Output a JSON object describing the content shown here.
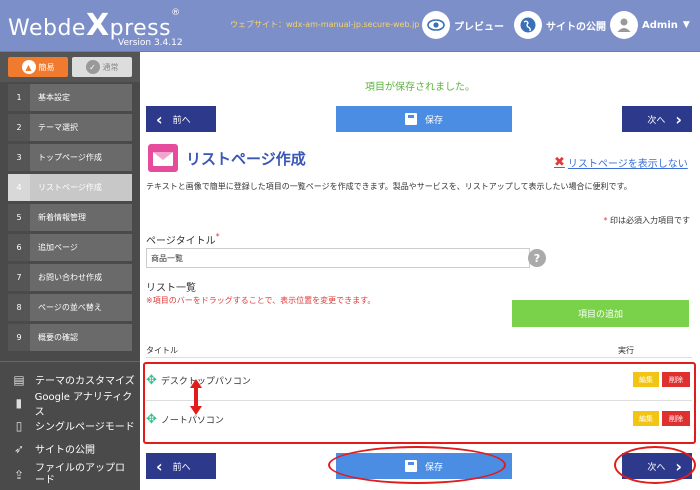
{
  "header": {
    "logo_pre": "Webde",
    "logo_x": "X",
    "logo_post": "press",
    "logo_reg": "®",
    "version": "Version 3.4.12",
    "site_url": "ウェブサイト：wdx-am-manual-jp.secure-web.jp",
    "preview_label": "プレビュー",
    "publish_label": "サイトの公開",
    "admin_label": "Admin"
  },
  "sidebar": {
    "mode_easy": "簡易",
    "mode_normal": "通常",
    "steps": [
      {
        "num": "1",
        "label": "基本設定"
      },
      {
        "num": "2",
        "label": "テーマ選択"
      },
      {
        "num": "3",
        "label": "トップページ作成"
      },
      {
        "num": "4",
        "label": "リストページ作成"
      },
      {
        "num": "5",
        "label": "新着情報管理"
      },
      {
        "num": "6",
        "label": "追加ページ"
      },
      {
        "num": "7",
        "label": "お問い合わせ作成"
      },
      {
        "num": "8",
        "label": "ページの並べ替え"
      },
      {
        "num": "9",
        "label": "概要の確認"
      }
    ],
    "links": [
      {
        "label": "テーマのカスタマイズ",
        "icon": "brush-icon"
      },
      {
        "label": "Google アナリティクス",
        "icon": "chart-icon"
      },
      {
        "label": "シングルページモード",
        "icon": "document-icon"
      },
      {
        "label": "サイトの公開",
        "icon": "rocket-icon"
      },
      {
        "label": "ファイルのアップロード",
        "icon": "upload-icon"
      }
    ]
  },
  "main": {
    "saved_message": "項目が保存されました。",
    "prev_label": "前へ",
    "save_label": "保存",
    "next_label": "次へ",
    "page_title": "リストページ作成",
    "hide_link": "リストページを表示しない",
    "description": "テキストと画像で簡単に登録した項目の一覧ページを作成できます。製品やサービスを、リストアップして表示したい場合に便利です。",
    "required_note": "印は必須入力項目です",
    "page_title_label": "ページタイトル",
    "page_title_value": "商品一覧",
    "list_label": "リスト一覧",
    "drag_note": "※項目のバーをドラッグすることで、表示位置を変更できます。",
    "add_item_label": "項目の追加",
    "col_title": "タイトル",
    "col_action": "実行",
    "items": [
      {
        "title": "デスクトップパソコン",
        "edit": "編集",
        "delete": "削除"
      },
      {
        "title": "ノートパソコン",
        "edit": "編集",
        "delete": "削除"
      }
    ]
  },
  "colors": {
    "header": "#7d8fc9",
    "sidebar": "#4a4a4a",
    "accent_orange": "#f07a2d",
    "nav_button": "#2d3a8c",
    "save_button": "#4a8de3",
    "add_button": "#7ad14a",
    "annotation": "#e21b1b"
  }
}
